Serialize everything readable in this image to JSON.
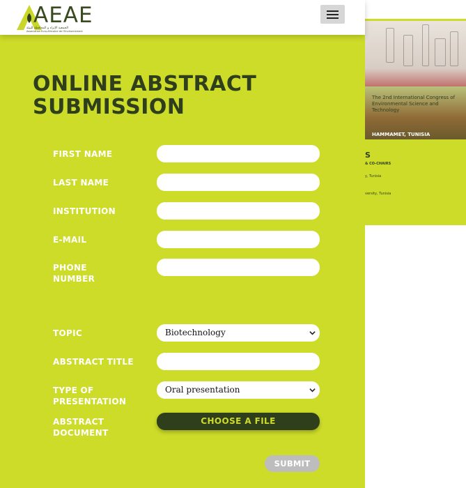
{
  "header": {
    "logo_text": "AEAE",
    "logo_subtitle_ar": "الجمعية الإثراء و المحافظة للبيئة",
    "logo_subtitle_fr": "Association Euro-Africaine de l'Environnement",
    "menu_icon": "hamburger-menu-icon"
  },
  "form": {
    "title": "ONLINE ABSTRACT SUBMISSION",
    "first_name_label": "FIRST NAME",
    "first_name_value": "",
    "last_name_label": "LAST NAME",
    "last_name_value": "",
    "institution_label": "INSTITUTION",
    "institution_value": "",
    "email_label": "E-MAIL",
    "email_value": "",
    "phone_label": "PHONE NUMBER",
    "phone_value": "",
    "topic_label": "TOPIC",
    "topic_selected": "Biotechnology",
    "abstract_title_label": "ABSTRACT TITLE",
    "abstract_title_value": "",
    "presentation_label": "TYPE OF PRESENTATION",
    "presentation_selected": "Oral presentation",
    "document_label": "ABSTRACT DOCUMENT",
    "choose_file_label": "CHOOSE A FILE",
    "submit_label": "SUBMIT"
  },
  "background_page": {
    "banner_text": "The 2nd International Congress of Environmental Science and Technology",
    "banner_city": "HAMMAMET, TUNISIA",
    "section_letter": "S",
    "section_sub": "& CO-CHAIRS",
    "line_1": "y, Tunisia",
    "line_2": "versity, Tunisia"
  },
  "colors": {
    "brand_lime": "#cddc29",
    "brand_dark_green": "#2f3f1c",
    "submit_disabled": "#bdbdbd"
  }
}
